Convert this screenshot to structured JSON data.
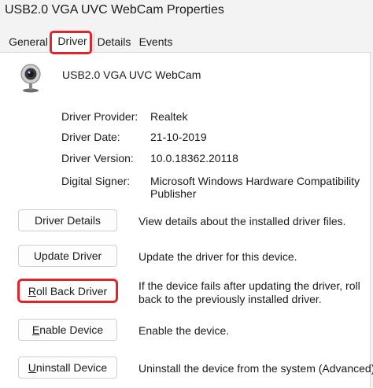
{
  "window": {
    "title": "USB2.0 VGA UVC WebCam Properties"
  },
  "tabs": [
    {
      "label": "General"
    },
    {
      "label": "Driver"
    },
    {
      "label": "Details"
    },
    {
      "label": "Events"
    }
  ],
  "selected_tab": "Driver",
  "device": {
    "name": "USB2.0 VGA UVC WebCam",
    "icon": "webcam-icon"
  },
  "info": {
    "provider_label": "Driver Provider:",
    "provider_value": "Realtek",
    "date_label": "Driver Date:",
    "date_value": "21-10-2019",
    "version_label": "Driver Version:",
    "version_value": "10.0.18362.20118",
    "signer_label": "Digital Signer:",
    "signer_value_line1": "Microsoft Windows Hardware Compatibility",
    "signer_value_line2": "Publisher"
  },
  "actions": {
    "details": {
      "label": "Driver Details",
      "description": "View details about the installed driver files."
    },
    "update": {
      "label": "Update Driver",
      "description": "Update the driver for this device."
    },
    "rollback": {
      "label": "Roll Back Driver",
      "label_mnemonic": "R",
      "label_rest": "oll Back Driver",
      "description_line1": "If the device fails after updating the driver, roll",
      "description_line2": "back to the previously installed driver."
    },
    "enable": {
      "label": "Enable Device",
      "label_mnemonic": "E",
      "label_rest": "nable Device",
      "description": "Enable the device."
    },
    "uninstall": {
      "label": "Uninstall Device",
      "label_mnemonic": "U",
      "label_rest": "ninstall Device",
      "description": "Uninstall the device from the system (Advanced)."
    }
  },
  "colors": {
    "highlight": "#e0242a",
    "window_bg": "#f3f3f3",
    "panel_bg": "#ffffff"
  }
}
